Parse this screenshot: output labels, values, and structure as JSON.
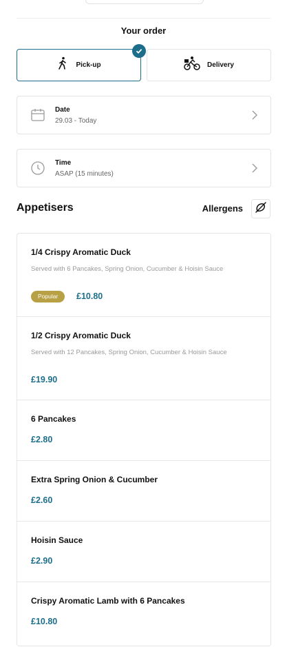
{
  "order": {
    "title": "Your order",
    "modes": [
      {
        "label": "Pick-up",
        "icon": "walking-person-icon",
        "selected": true
      },
      {
        "label": "Delivery",
        "icon": "delivery-cyclist-icon",
        "selected": false
      }
    ],
    "date": {
      "title": "Date",
      "value": "29.03 - Today",
      "icon": "calendar-icon"
    },
    "time": {
      "title": "Time",
      "value": "ASAP (15 minutes)",
      "icon": "clock-icon"
    }
  },
  "section": {
    "title": "Appetisers",
    "allergens_label": "Allergens",
    "allergens_icon": "allergens-icon"
  },
  "menu": [
    {
      "name": "1/4 Crispy Aromatic Duck",
      "description": "Served with 6 Pancakes, Spring Onion, Cucumber & Hoisin Sauce",
      "badge": "Popular",
      "price": "£10.80"
    },
    {
      "name": "1/2 Crispy Aromatic Duck",
      "description": "Served with 12 Pancakes, Spring Onion, Cucumber & Hoisin Sauce",
      "price": "£19.90"
    },
    {
      "name": "6 Pancakes",
      "price": "£2.80"
    },
    {
      "name": "Extra Spring Onion & Cucumber",
      "price": "£2.60"
    },
    {
      "name": "Hoisin Sauce",
      "price": "£2.90"
    },
    {
      "name": "Crispy Aromatic Lamb with 6 Pancakes",
      "price": "£10.80"
    }
  ],
  "colors": {
    "accent": "#1d6e8b",
    "badge": "#b8a044"
  }
}
